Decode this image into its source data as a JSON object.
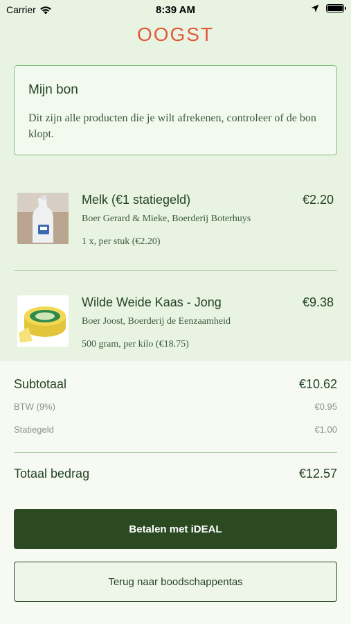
{
  "status": {
    "carrier": "Carrier",
    "time": "8:39 AM"
  },
  "brand": {
    "logo_text": "OOGST",
    "accent": "#e05a39",
    "primary": "#2b4a22"
  },
  "receipt": {
    "title": "Mijn bon",
    "description": "Dit zijn alle producten die je wilt afrekenen, controleer of de bon klopt."
  },
  "products": [
    {
      "name": "Melk (€1 statiegeld)",
      "price": "€2.20",
      "farmer": "Boer Gerard & Mieke, Boerderij Boterhuys",
      "quantity": "1 x, per stuk (€2.20)"
    },
    {
      "name": "Wilde Weide Kaas - Jong",
      "price": "€9.38",
      "farmer": "Boer Joost, Boerderij de Eenzaamheid",
      "quantity": "500 gram, per kilo (€18.75)"
    }
  ],
  "summary": {
    "subtotal_label": "Subtotaal",
    "subtotal_value": "€10.62",
    "vat_label": "BTW (9%)",
    "vat_value": "€0.95",
    "deposit_label": "Statiegeld",
    "deposit_value": "€1.00",
    "total_label": "Totaal bedrag",
    "total_value": "€12.57"
  },
  "actions": {
    "pay_label": "Betalen met iDEAL",
    "back_label": "Terug naar boodschappentas"
  }
}
